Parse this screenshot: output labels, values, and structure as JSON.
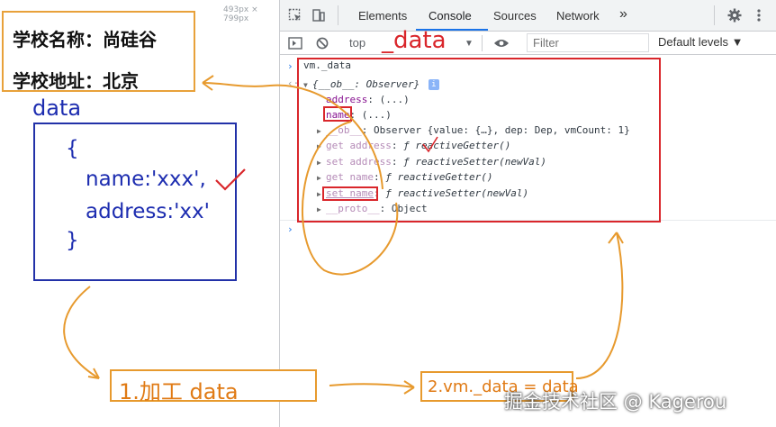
{
  "page": {
    "size_readout": "493px × 799px",
    "school_name": "学校名称：尚硅谷",
    "school_address": "学校地址：北京",
    "data_label": "data",
    "data_object": {
      "open_brace": "{",
      "name_line": "name:'xxx',",
      "address_line": "address:'xx'",
      "close_brace": "}"
    }
  },
  "devtools": {
    "tabs": [
      {
        "label": "Elements"
      },
      {
        "label": "Console",
        "active": true
      },
      {
        "label": "Sources"
      },
      {
        "label": "Network"
      }
    ],
    "more_tabs": "»",
    "toolbar": {
      "context": "top",
      "filter_placeholder": "Filter",
      "levels": "Default levels ▼"
    },
    "console": {
      "input_command": "vm._data",
      "object_header": "{__ob__: Observer}",
      "info_badge": "i",
      "rows": [
        {
          "key": "address",
          "sep": ": ",
          "value": "(...)"
        },
        {
          "key": "name",
          "sep": ": ",
          "value": "(...)"
        },
        {
          "key": "__ob__",
          "sep": ": ",
          "value": "Observer {value: {…}, dep: Dep, vmCount: 1}"
        },
        {
          "key": "get address",
          "sep": ": ",
          "value": "ƒ reactiveGetter()"
        },
        {
          "key": "set address",
          "sep": ": ",
          "value": "ƒ reactiveSetter(newVal)"
        },
        {
          "key": "get name",
          "sep": ": ",
          "value": "ƒ reactiveGetter()"
        },
        {
          "key": "set name",
          "sep": ": ",
          "value": "ƒ reactiveSetter(newVal)"
        },
        {
          "key": "__proto__",
          "sep": ": ",
          "value": "Object"
        }
      ],
      "prompt": "›"
    }
  },
  "annotations": {
    "handwritten_data": "_data",
    "step1": "1.加工 data",
    "step2": "2.vm._data = data",
    "watermark": "掘金技术社区 @ Kagerou"
  },
  "colors": {
    "accent_blue": "#1a73e8",
    "annotation_red": "#d9262b",
    "annotation_orange": "#e79a2e",
    "data_blue": "#1d2db0"
  }
}
